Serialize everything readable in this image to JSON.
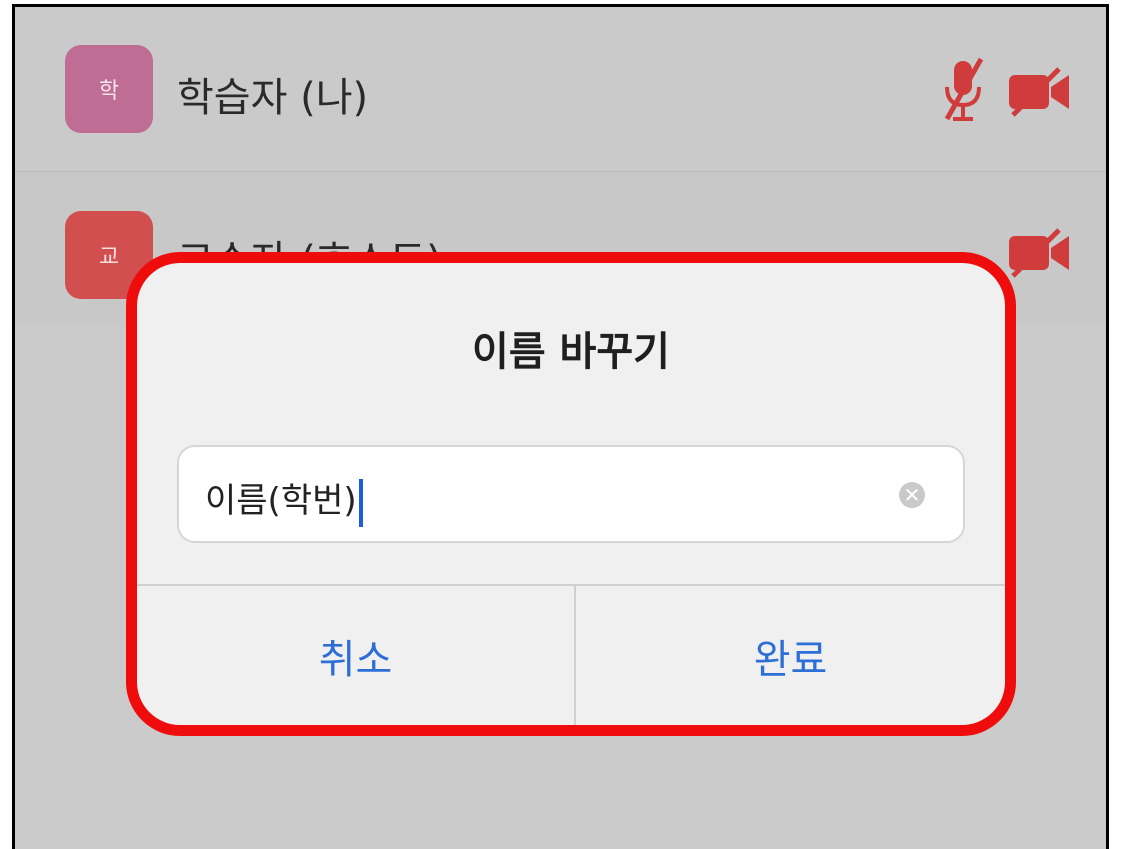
{
  "participants": [
    {
      "avatar_char": "학",
      "name": "학습자 (나)",
      "mic_icon": "mic-muted-icon",
      "video_icon": "video-off-icon"
    },
    {
      "avatar_char": "교",
      "name": "교수자 (호스트)",
      "video_icon": "video-off-icon"
    }
  ],
  "dialog": {
    "title": "이름 바꾸기",
    "input_value": "이름(학번)",
    "cancel_label": "취소",
    "done_label": "완료"
  },
  "colors": {
    "highlight_border": "#ef0c0c",
    "button_text": "#2d6fd6",
    "mute_icon": "#d03c3c",
    "avatar_learner": "#bf6d94",
    "avatar_instructor": "#d1504f"
  }
}
